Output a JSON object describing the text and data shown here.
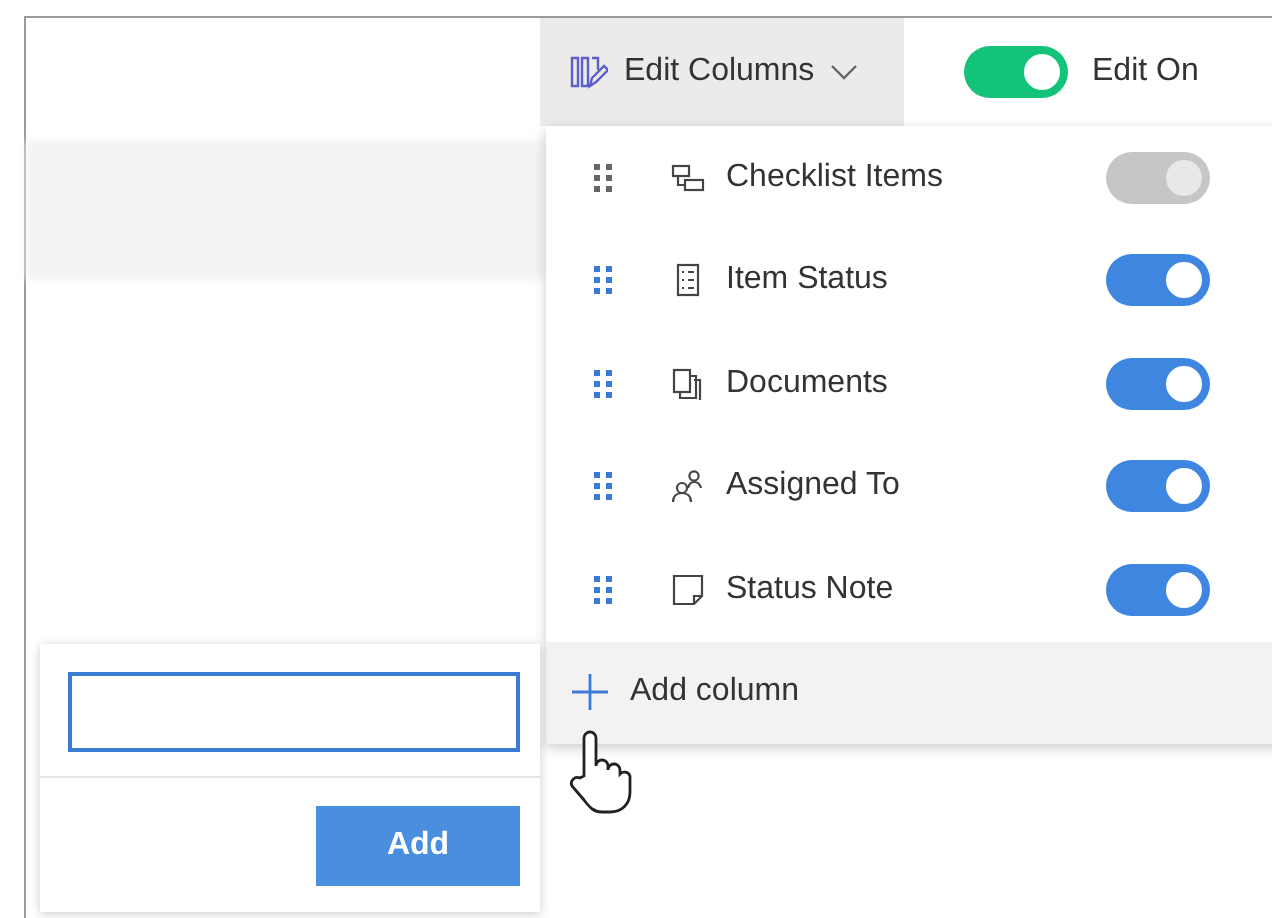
{
  "toolbar": {
    "edit_columns": "Edit Columns",
    "edit_toggle": {
      "label": "Edit On",
      "on": true
    }
  },
  "columns": [
    {
      "label": "Checklist Items",
      "on": true,
      "disabled": true
    },
    {
      "label": "Item Status",
      "on": true,
      "disabled": false
    },
    {
      "label": "Documents",
      "on": true,
      "disabled": false
    },
    {
      "label": "Assigned To",
      "on": true,
      "disabled": false
    },
    {
      "label": "Status Note",
      "on": true,
      "disabled": false
    }
  ],
  "add_column": {
    "label": "Add column"
  },
  "new_column_popup": {
    "button": "Add"
  }
}
